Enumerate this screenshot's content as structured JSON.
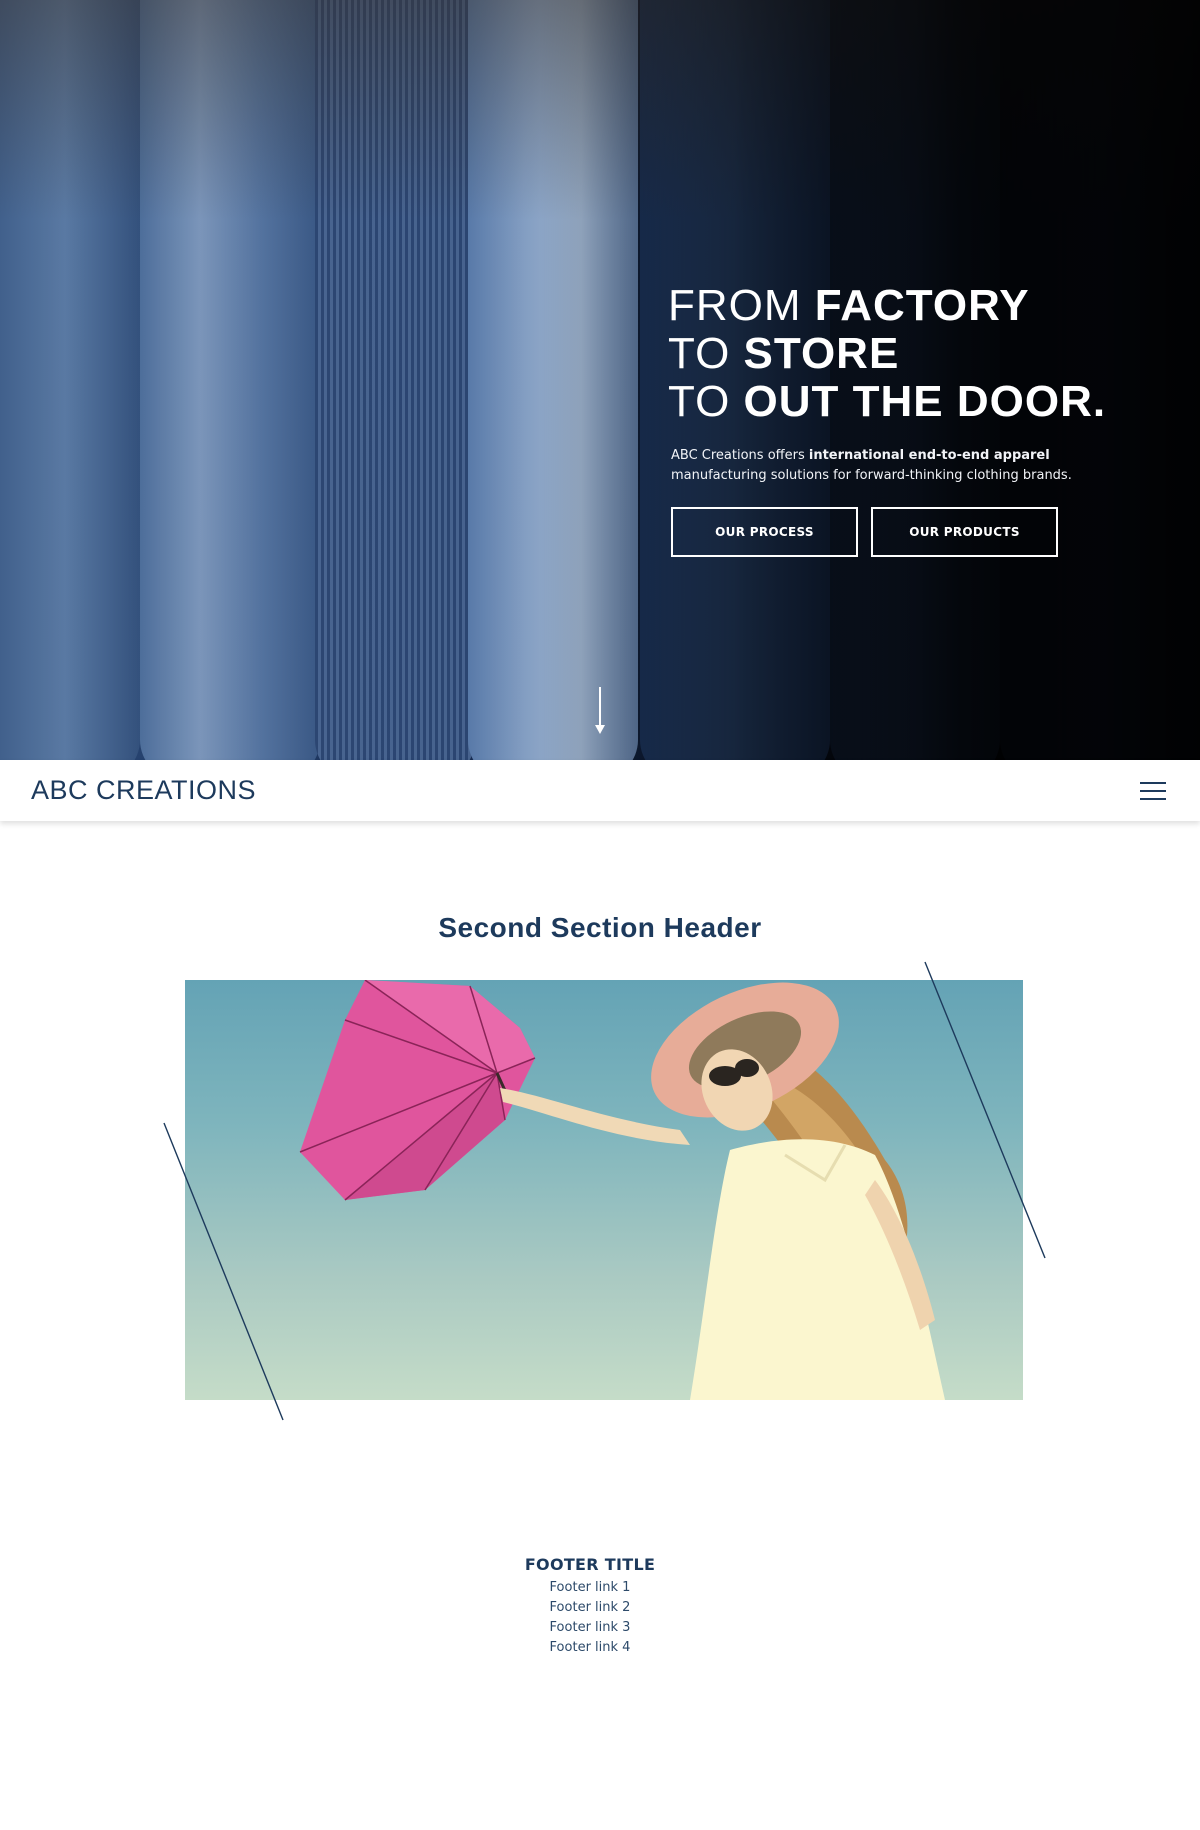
{
  "hero": {
    "headline": {
      "line1_light": "FROM ",
      "line1_bold": "FACTORY",
      "line2_light": "TO ",
      "line2_bold": "STORE",
      "line3_light": "TO ",
      "line3_bold": "OUT THE DOOR."
    },
    "tagline": {
      "prefix": "ABC Creations offers ",
      "bold": "international end-to-end apparel",
      "suffix": "manufacturing solutions for forward-thinking clothing brands."
    },
    "buttons": {
      "process_label": "OUR PROCESS",
      "products_label": "OUR PRODUCTS"
    },
    "scroll_icon": "arrow-down-icon"
  },
  "navbar": {
    "brand": "ABC CREATIONS",
    "menu_icon": "hamburger-menu-icon"
  },
  "second_section": {
    "header": "Second Section Header",
    "image": "woman-with-pink-umbrella-photo"
  },
  "footer": {
    "title": "FOOTER TITLE",
    "links": [
      "Footer link 1",
      "Footer link 2",
      "Footer link 3",
      "Footer link 4"
    ]
  },
  "colors": {
    "brand_navy": "#1d3a5c",
    "hero_dark": "#000000",
    "hero_blue": "#2b4a78",
    "umbrella_pink": "#e0559d",
    "white": "#ffffff"
  }
}
